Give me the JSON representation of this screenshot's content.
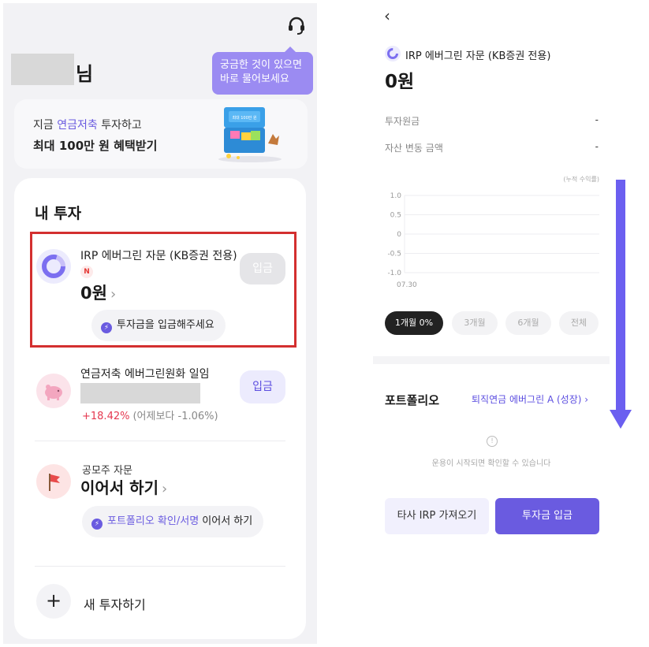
{
  "colors": {
    "accent": "#6a5be0",
    "tooltip": "#9b8bf2",
    "highlight_box": "#d32f2f",
    "gain": "#e53950",
    "arrow": "#6b5ff0"
  },
  "left_screen": {
    "header": {
      "support_icon": "headset-icon",
      "name_suffix": "님"
    },
    "tooltip": {
      "line1": "궁금한 것이 있으면",
      "line2": "바로 물어보세요"
    },
    "banner": {
      "line1_prefix": "지금 ",
      "line1_highlight": "연금저축",
      "line1_suffix": " 투자하고",
      "line2": "최대 100만 원 혜택받기",
      "image_label": "최대 100만 원"
    },
    "my_investments": {
      "title": "내 투자",
      "products": [
        {
          "title": "IRP 에버그린 자문 (KB증권 전용)",
          "badge": "N",
          "amount": "0원",
          "deposit_label": "입금",
          "notice": "투자금을 입금해주세요",
          "icon": "irp-ring-icon"
        },
        {
          "title": "연금저축 에버그린원화 일임",
          "gain": "+18.42%",
          "gain_detail": "(어제보다 -1.06%)",
          "deposit_label": "입금",
          "icon": "piggy-bank-icon"
        },
        {
          "title": "공모주 자문",
          "continue_label": "이어서 하기",
          "notice_highlight": "포트폴리오 확인/서명",
          "notice_rest": " 이어서 하기",
          "icon": "flag-icon"
        }
      ],
      "new_investment": {
        "plus": "+",
        "label": "새 투자하기"
      }
    }
  },
  "right_screen": {
    "back_icon": "back-arrow-icon",
    "product_title": "IRP 에버그린 자문 (KB증권 전용)",
    "amount": "0원",
    "rows": [
      {
        "label": "투자원금",
        "value": "-"
      },
      {
        "label": "자산 변동 금액",
        "value": "-"
      }
    ],
    "chart_data": {
      "type": "line",
      "title": "",
      "ylabel": "(누적 수익률)",
      "ylim": [
        -1.0,
        1.0
      ],
      "y_ticks": [
        "1.0",
        "0.5",
        "0",
        "-0.5",
        "-1.0"
      ],
      "x": [
        "07.30"
      ],
      "series": [
        {
          "values": []
        }
      ],
      "grid": true
    },
    "range_buttons": [
      {
        "label": "1개월 0%",
        "active": true
      },
      {
        "label": "3개월",
        "active": false
      },
      {
        "label": "6개월",
        "active": false
      },
      {
        "label": "전체",
        "active": false
      }
    ],
    "portfolio": {
      "title": "포트폴리오",
      "link": "퇴직연금 에버그린 A (성장) ›"
    },
    "info": {
      "icon": "!",
      "text": "운용이 시작되면 확인할 수 있습니다"
    },
    "buttons": {
      "other_irp": "타사 IRP 가져오기",
      "deposit": "투자금 입금"
    }
  }
}
